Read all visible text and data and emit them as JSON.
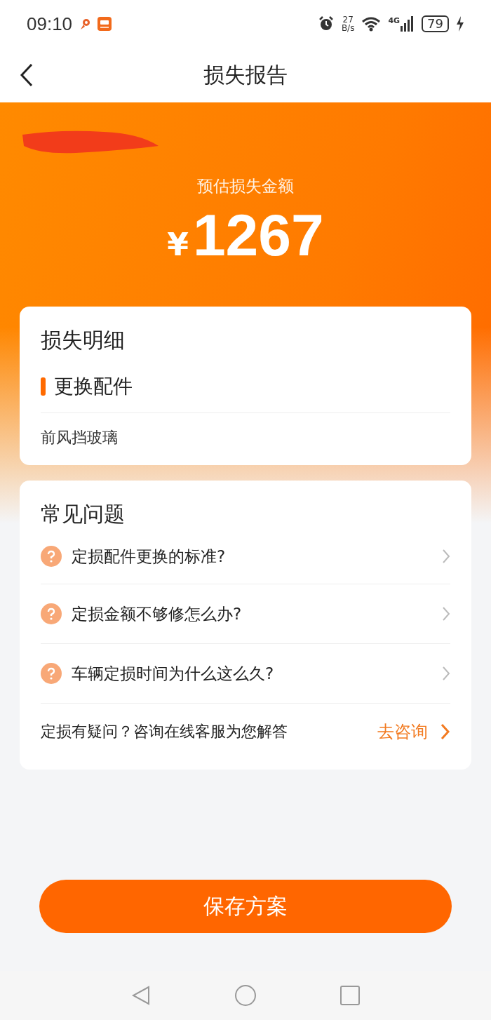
{
  "status_bar": {
    "time": "09:10",
    "speed_value": "27",
    "speed_unit": "B/s",
    "network": "4G",
    "battery": "79"
  },
  "nav": {
    "title": "损失报告"
  },
  "header": {
    "label": "预估损失金额",
    "currency": "¥",
    "amount": "1267"
  },
  "loss_detail": {
    "title": "损失明细",
    "section": "更换配件",
    "items": [
      "前风挡玻璃"
    ]
  },
  "faq": {
    "title": "常见问题",
    "questions": [
      "定损配件更换的标准?",
      "定损金额不够修怎么办?",
      "车辆定损时间为什么这么久?"
    ],
    "consult_text": "定损有疑问？咨询在线客服为您解答",
    "consult_link": "去咨询"
  },
  "save_button": "保存方案"
}
